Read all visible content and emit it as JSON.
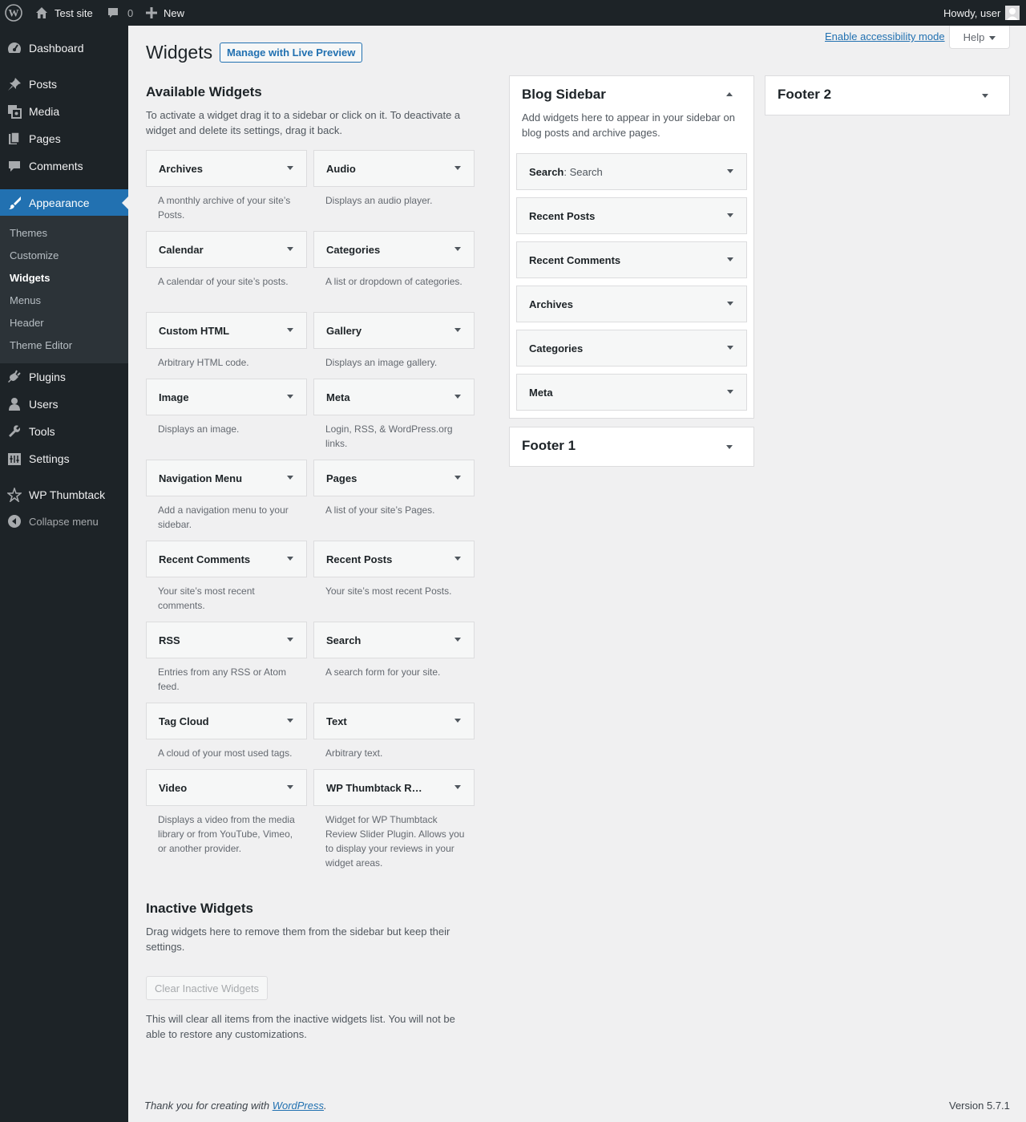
{
  "admin_bar": {
    "site_name": "Test site",
    "comments_count": "0",
    "new_label": "New",
    "howdy": "Howdy, user"
  },
  "menu": {
    "dashboard": "Dashboard",
    "posts": "Posts",
    "media": "Media",
    "pages": "Pages",
    "comments": "Comments",
    "appearance": "Appearance",
    "submenu": [
      "Themes",
      "Customize",
      "Widgets",
      "Menus",
      "Header",
      "Theme Editor"
    ],
    "plugins": "Plugins",
    "users": "Users",
    "tools": "Tools",
    "settings": "Settings",
    "wp_thumbtack": "WP Thumbtack",
    "collapse": "Collapse menu"
  },
  "header": {
    "title": "Widgets",
    "live_preview": "Manage with Live Preview",
    "a11y": "Enable accessibility mode",
    "help": "Help"
  },
  "available": {
    "title": "Available Widgets",
    "desc": "To activate a widget drag it to a sidebar or click on it. To deactivate a widget and delete its settings, drag it back.",
    "widgets": [
      {
        "name": "Archives",
        "desc": "A monthly archive of your site’s Posts."
      },
      {
        "name": "Audio",
        "desc": "Displays an audio player."
      },
      {
        "name": "Calendar",
        "desc": "A calendar of your site’s posts."
      },
      {
        "name": "Categories",
        "desc": "A list or dropdown of categories."
      },
      {
        "name": "Custom HTML",
        "desc": "Arbitrary HTML code."
      },
      {
        "name": "Gallery",
        "desc": "Displays an image gallery."
      },
      {
        "name": "Image",
        "desc": "Displays an image."
      },
      {
        "name": "Meta",
        "desc": "Login, RSS, & WordPress.org links."
      },
      {
        "name": "Navigation Menu",
        "desc": "Add a navigation menu to your sidebar."
      },
      {
        "name": "Pages",
        "desc": "A list of your site’s Pages."
      },
      {
        "name": "Recent Comments",
        "desc": "Your site’s most recent comments."
      },
      {
        "name": "Recent Posts",
        "desc": "Your site’s most recent Posts."
      },
      {
        "name": "RSS",
        "desc": "Entries from any RSS or Atom feed."
      },
      {
        "name": "Search",
        "desc": "A search form for your site."
      },
      {
        "name": "Tag Cloud",
        "desc": "A cloud of your most used tags."
      },
      {
        "name": "Text",
        "desc": "Arbitrary text."
      },
      {
        "name": "Video",
        "desc": "Displays a video from the media library or from YouTube, Vimeo, or another provider."
      },
      {
        "name": "WP Thumbtack R…",
        "desc": "Widget for WP Thumbtack Review Slider Plugin. Allows you to display your reviews in your widget areas."
      }
    ]
  },
  "inactive": {
    "title": "Inactive Widgets",
    "desc": "Drag widgets here to remove them from the sidebar but keep their settings.",
    "clear_button": "Clear Inactive Widgets",
    "clear_desc": "This will clear all items from the inactive widgets list. You will not be able to restore any customizations."
  },
  "blog_sidebar": {
    "title": "Blog Sidebar",
    "desc": "Add widgets here to appear in your sidebar on blog posts and archive pages.",
    "widgets": [
      {
        "name": "Search",
        "sub": ": Search"
      },
      {
        "name": "Recent Posts",
        "sub": ""
      },
      {
        "name": "Recent Comments",
        "sub": ""
      },
      {
        "name": "Archives",
        "sub": ""
      },
      {
        "name": "Categories",
        "sub": ""
      },
      {
        "name": "Meta",
        "sub": ""
      }
    ]
  },
  "footer1": {
    "title": "Footer 1"
  },
  "footer2": {
    "title": "Footer 2"
  },
  "footer": {
    "thanks_prefix": "Thank you for creating with ",
    "wordpress_link": "WordPress",
    "thanks_suffix": ".",
    "version": "Version 5.7.1"
  }
}
